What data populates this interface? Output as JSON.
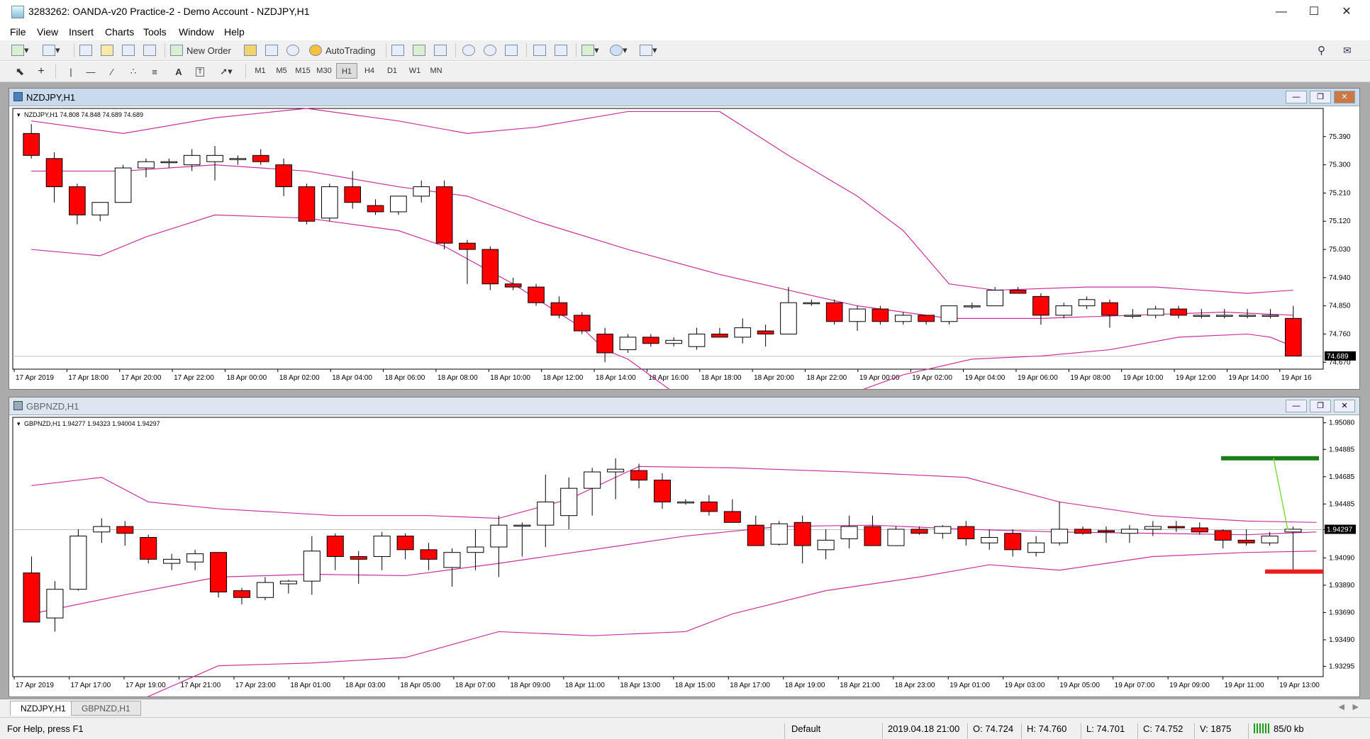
{
  "window": {
    "title": "3283262: OANDA-v20 Practice-2 - Demo Account - NZDJPY,H1",
    "minimize": "—",
    "maximize": "☐",
    "close": "✕"
  },
  "menu": [
    "File",
    "View",
    "Insert",
    "Charts",
    "Tools",
    "Window",
    "Help"
  ],
  "toolbar": {
    "new_order": "New Order",
    "autotrading": "AutoTrading"
  },
  "timeframes": [
    "M1",
    "M5",
    "M15",
    "M30",
    "H1",
    "H4",
    "D1",
    "W1",
    "MN"
  ],
  "active_timeframe": "H1",
  "tabs": [
    "NZDJPY,H1",
    "GBPNZD,H1"
  ],
  "status": {
    "help": "For Help, press F1",
    "profile": "Default",
    "datetime": "2019.04.18 21:00",
    "open": "O: 74.724",
    "high": "H: 74.760",
    "low": "L: 74.701",
    "close": "C: 74.752",
    "volume": "V: 1875",
    "traffic": "85/0 kb"
  },
  "colors": {
    "bear": "#ff0000",
    "bull": "#ffffff",
    "bands": "#cc2f9b",
    "tp_line": "#1a7d1a",
    "sl_line": "#ee1c1c"
  },
  "chart_data": [
    {
      "type": "candlestick",
      "window_title": "NZDJPY,H1",
      "info": "NZDJPY,H1  74.808 74.848 74.689 74.689",
      "price_labels": [
        "75.390",
        "75.300",
        "75.210",
        "75.120",
        "75.030",
        "74.940",
        "74.850",
        "74.760",
        "74.670"
      ],
      "current_price": "74.689",
      "ylim": [
        74.648,
        75.48
      ],
      "time_labels": [
        "17 Apr 2019",
        "17 Apr 18:00",
        "17 Apr 20:00",
        "17 Apr 22:00",
        "18 Apr 00:00",
        "18 Apr 02:00",
        "18 Apr 04:00",
        "18 Apr 06:00",
        "18 Apr 08:00",
        "18 Apr 10:00",
        "18 Apr 12:00",
        "18 Apr 14:00",
        "18 Apr 16:00",
        "18 Apr 18:00",
        "18 Apr 20:00",
        "18 Apr 22:00",
        "19 Apr 00:00",
        "19 Apr 02:00",
        "19 Apr 04:00",
        "19 Apr 06:00",
        "19 Apr 08:00",
        "19 Apr 10:00",
        "19 Apr 12:00",
        "19 Apr 14:00",
        "19 Apr 16"
      ],
      "candles": [
        [
          75.4,
          75.43,
          75.32,
          75.33
        ],
        [
          75.32,
          75.34,
          75.18,
          75.23
        ],
        [
          75.23,
          75.24,
          75.11,
          75.14
        ],
        [
          75.14,
          75.18,
          75.12,
          75.18
        ],
        [
          75.18,
          75.3,
          75.18,
          75.29
        ],
        [
          75.29,
          75.32,
          75.26,
          75.31
        ],
        [
          75.31,
          75.32,
          75.29,
          75.31
        ],
        [
          75.3,
          75.35,
          75.28,
          75.33
        ],
        [
          75.31,
          75.36,
          75.25,
          75.33
        ],
        [
          75.32,
          75.33,
          75.3,
          75.32
        ],
        [
          75.33,
          75.35,
          75.3,
          75.31
        ],
        [
          75.3,
          75.32,
          75.2,
          75.23
        ],
        [
          75.23,
          75.24,
          75.11,
          75.12
        ],
        [
          75.13,
          75.24,
          75.12,
          75.23
        ],
        [
          75.23,
          75.28,
          75.16,
          75.18
        ],
        [
          75.17,
          75.19,
          75.14,
          75.15
        ],
        [
          75.15,
          75.2,
          75.14,
          75.2
        ],
        [
          75.2,
          75.25,
          75.18,
          75.23
        ],
        [
          75.23,
          75.25,
          75.03,
          75.05
        ],
        [
          75.05,
          75.06,
          74.92,
          75.03
        ],
        [
          75.03,
          75.04,
          74.9,
          74.92
        ],
        [
          74.92,
          74.94,
          74.9,
          74.91
        ],
        [
          74.91,
          74.92,
          74.85,
          74.86
        ],
        [
          74.86,
          74.88,
          74.81,
          74.82
        ],
        [
          74.82,
          74.83,
          74.76,
          74.77
        ],
        [
          74.76,
          74.78,
          74.67,
          74.7
        ],
        [
          74.71,
          74.76,
          74.7,
          74.75
        ],
        [
          74.75,
          74.76,
          74.72,
          74.73
        ],
        [
          74.73,
          74.75,
          74.72,
          74.74
        ],
        [
          74.72,
          74.78,
          74.71,
          74.76
        ],
        [
          74.76,
          74.78,
          74.75,
          74.75
        ],
        [
          74.75,
          74.81,
          74.73,
          74.78
        ],
        [
          74.77,
          74.79,
          74.72,
          74.76
        ],
        [
          74.76,
          74.91,
          74.76,
          74.86
        ],
        [
          74.86,
          74.87,
          74.85,
          74.86
        ],
        [
          74.86,
          74.87,
          74.79,
          74.8
        ],
        [
          74.8,
          74.85,
          74.77,
          74.84
        ],
        [
          74.84,
          74.85,
          74.79,
          74.8
        ],
        [
          74.8,
          74.83,
          74.79,
          74.82
        ],
        [
          74.82,
          74.82,
          74.79,
          74.8
        ],
        [
          74.8,
          74.85,
          74.79,
          74.85
        ],
        [
          74.85,
          74.86,
          74.84,
          74.85
        ],
        [
          74.85,
          74.91,
          74.85,
          74.9
        ],
        [
          74.9,
          74.91,
          74.89,
          74.89
        ],
        [
          74.88,
          74.89,
          74.79,
          74.82
        ],
        [
          74.82,
          74.86,
          74.81,
          74.85
        ],
        [
          74.85,
          74.88,
          74.84,
          74.87
        ],
        [
          74.86,
          74.87,
          74.78,
          74.82
        ],
        [
          74.82,
          74.84,
          74.81,
          74.82
        ],
        [
          74.82,
          74.85,
          74.81,
          74.84
        ],
        [
          74.84,
          74.85,
          74.81,
          74.82
        ],
        [
          74.82,
          74.84,
          74.81,
          74.82
        ],
        [
          74.82,
          74.84,
          74.81,
          74.82
        ],
        [
          74.82,
          74.84,
          74.81,
          74.82
        ],
        [
          74.82,
          74.84,
          74.81,
          74.82
        ],
        [
          74.81,
          74.85,
          74.69,
          74.69
        ]
      ],
      "bands": {
        "upper": [
          [
            0,
            75.44
          ],
          [
            4,
            75.4
          ],
          [
            8,
            75.45
          ],
          [
            12,
            75.48
          ],
          [
            16,
            75.44
          ],
          [
            19,
            75.4
          ],
          [
            22,
            75.42
          ],
          [
            26,
            75.47
          ],
          [
            30,
            75.47
          ],
          [
            33,
            75.33
          ],
          [
            36,
            75.2
          ],
          [
            38,
            75.09
          ],
          [
            40,
            74.92
          ],
          [
            42,
            74.9
          ],
          [
            46,
            74.91
          ],
          [
            49,
            74.91
          ],
          [
            53,
            74.89
          ],
          [
            55,
            74.9
          ]
        ],
        "middle": [
          [
            0,
            75.28
          ],
          [
            4,
            75.28
          ],
          [
            8,
            75.3
          ],
          [
            12,
            75.28
          ],
          [
            16,
            75.23
          ],
          [
            19,
            75.2
          ],
          [
            22,
            75.12
          ],
          [
            26,
            75.03
          ],
          [
            30,
            74.95
          ],
          [
            33,
            74.9
          ],
          [
            36,
            74.85
          ],
          [
            40,
            74.81
          ],
          [
            44,
            74.81
          ],
          [
            48,
            74.82
          ],
          [
            52,
            74.83
          ],
          [
            55,
            74.82
          ]
        ],
        "lower": [
          [
            0,
            75.03
          ],
          [
            3,
            75.01
          ],
          [
            5,
            75.07
          ],
          [
            8,
            75.14
          ],
          [
            12,
            75.13
          ],
          [
            16,
            75.09
          ],
          [
            18,
            75.04
          ],
          [
            21,
            74.92
          ],
          [
            24,
            74.78
          ],
          [
            25,
            74.71
          ],
          [
            26,
            74.68
          ],
          [
            29,
            74.52
          ],
          [
            32,
            74.55
          ],
          [
            35,
            74.55
          ],
          [
            38,
            74.63
          ],
          [
            41,
            74.68
          ],
          [
            44,
            74.69
          ],
          [
            47,
            74.71
          ],
          [
            50,
            74.75
          ],
          [
            53,
            74.76
          ],
          [
            54,
            74.75
          ],
          [
            55,
            74.72
          ]
        ]
      }
    },
    {
      "type": "candlestick",
      "window_title": "GBPNZD,H1",
      "info": "GBPNZD,H1  1.94277 1.94323 1.94004 1.94297",
      "price_labels": [
        "1.95080",
        "1.94885",
        "1.94685",
        "1.94485",
        "1.94297",
        "1.94090",
        "1.93890",
        "1.93690",
        "1.93490",
        "1.93295"
      ],
      "current_price": "1.94297",
      "ylim": [
        1.9322,
        1.9512
      ],
      "tp_price": 1.9482,
      "sl_price": 1.9399,
      "time_labels": [
        "17 Apr 2019",
        "17 Apr 17:00",
        "17 Apr 19:00",
        "17 Apr 21:00",
        "17 Apr 23:00",
        "18 Apr 01:00",
        "18 Apr 03:00",
        "18 Apr 05:00",
        "18 Apr 07:00",
        "18 Apr 09:00",
        "18 Apr 11:00",
        "18 Apr 13:00",
        "18 Apr 15:00",
        "18 Apr 17:00",
        "18 Apr 19:00",
        "18 Apr 21:00",
        "18 Apr 23:00",
        "19 Apr 01:00",
        "19 Apr 03:00",
        "19 Apr 05:00",
        "19 Apr 07:00",
        "19 Apr 09:00",
        "19 Apr 11:00",
        "19 Apr 13:00"
      ],
      "candles": [
        [
          1.9398,
          1.941,
          1.937,
          1.9362
        ],
        [
          1.9365,
          1.9392,
          1.9355,
          1.9386
        ],
        [
          1.9386,
          1.943,
          1.9385,
          1.9425
        ],
        [
          1.9428,
          1.9438,
          1.942,
          1.9432
        ],
        [
          1.9432,
          1.9436,
          1.9418,
          1.9427
        ],
        [
          1.9424,
          1.9426,
          1.9405,
          1.9408
        ],
        [
          1.9405,
          1.9412,
          1.94,
          1.9408
        ],
        [
          1.9406,
          1.9415,
          1.94,
          1.9412
        ],
        [
          1.9413,
          1.9413,
          1.938,
          1.9384
        ],
        [
          1.9385,
          1.9387,
          1.9375,
          1.938
        ],
        [
          1.938,
          1.9395,
          1.9378,
          1.9391
        ],
        [
          1.939,
          1.9393,
          1.9383,
          1.9392
        ],
        [
          1.9392,
          1.9425,
          1.9382,
          1.9414
        ],
        [
          1.9425,
          1.9427,
          1.94,
          1.941
        ],
        [
          1.941,
          1.9414,
          1.939,
          1.9408
        ],
        [
          1.941,
          1.9428,
          1.94,
          1.9425
        ],
        [
          1.9425,
          1.9427,
          1.9408,
          1.9415
        ],
        [
          1.9415,
          1.942,
          1.94,
          1.9408
        ],
        [
          1.9402,
          1.9416,
          1.9388,
          1.9413
        ],
        [
          1.9413,
          1.943,
          1.94,
          1.9417
        ],
        [
          1.9417,
          1.944,
          1.9395,
          1.9433
        ],
        [
          1.9433,
          1.9435,
          1.941,
          1.9433
        ],
        [
          1.9433,
          1.947,
          1.9417,
          1.945
        ],
        [
          1.944,
          1.9468,
          1.943,
          1.946
        ],
        [
          1.946,
          1.9475,
          1.944,
          1.9472
        ],
        [
          1.9472,
          1.9482,
          1.9452,
          1.9474
        ],
        [
          1.9473,
          1.9478,
          1.946,
          1.9466
        ],
        [
          1.9466,
          1.9471,
          1.9445,
          1.945
        ],
        [
          1.945,
          1.9452,
          1.9448,
          1.945
        ],
        [
          1.945,
          1.9455,
          1.944,
          1.9443
        ],
        [
          1.9443,
          1.9452,
          1.9435,
          1.9435
        ],
        [
          1.9433,
          1.944,
          1.9418,
          1.9418
        ],
        [
          1.9419,
          1.9436,
          1.9418,
          1.9434
        ],
        [
          1.9435,
          1.944,
          1.9405,
          1.9418
        ],
        [
          1.9415,
          1.943,
          1.9408,
          1.9422
        ],
        [
          1.9423,
          1.944,
          1.9416,
          1.9432
        ],
        [
          1.9432,
          1.944,
          1.9418,
          1.9418
        ],
        [
          1.9418,
          1.9432,
          1.9418,
          1.943
        ],
        [
          1.943,
          1.9432,
          1.9426,
          1.9427
        ],
        [
          1.9427,
          1.9433,
          1.9423,
          1.9432
        ],
        [
          1.9432,
          1.9436,
          1.9418,
          1.9423
        ],
        [
          1.942,
          1.943,
          1.9415,
          1.9424
        ],
        [
          1.9427,
          1.943,
          1.941,
          1.9415
        ],
        [
          1.9413,
          1.9425,
          1.941,
          1.942
        ],
        [
          1.942,
          1.945,
          1.9418,
          1.943
        ],
        [
          1.943,
          1.9432,
          1.9426,
          1.9427
        ],
        [
          1.9429,
          1.9432,
          1.942,
          1.9428
        ],
        [
          1.9427,
          1.9433,
          1.942,
          1.943
        ],
        [
          1.943,
          1.9436,
          1.9425,
          1.9432
        ],
        [
          1.9432,
          1.9436,
          1.9428,
          1.9431
        ],
        [
          1.9431,
          1.9435,
          1.9426,
          1.9428
        ],
        [
          1.9429,
          1.943,
          1.9416,
          1.9422
        ],
        [
          1.9422,
          1.943,
          1.9418,
          1.942
        ],
        [
          1.942,
          1.9428,
          1.9418,
          1.9425
        ],
        [
          1.9428,
          1.9432,
          1.94,
          1.943
        ]
      ],
      "bands": {
        "upper": [
          [
            0,
            1.9462
          ],
          [
            3,
            1.9468
          ],
          [
            5,
            1.945
          ],
          [
            8,
            1.9445
          ],
          [
            13,
            1.944
          ],
          [
            17,
            1.944
          ],
          [
            20,
            1.9438
          ],
          [
            23,
            1.9452
          ],
          [
            26,
            1.9476
          ],
          [
            30,
            1.9475
          ],
          [
            35,
            1.9472
          ],
          [
            40,
            1.9468
          ],
          [
            44,
            1.945
          ],
          [
            48,
            1.944
          ],
          [
            52,
            1.9436
          ],
          [
            55,
            1.9435
          ]
        ],
        "middle": [
          [
            0,
            1.9368
          ],
          [
            4,
            1.9382
          ],
          [
            8,
            1.9395
          ],
          [
            12,
            1.9397
          ],
          [
            16,
            1.9396
          ],
          [
            20,
            1.9405
          ],
          [
            24,
            1.9415
          ],
          [
            28,
            1.9425
          ],
          [
            32,
            1.9432
          ],
          [
            36,
            1.9433
          ],
          [
            40,
            1.943
          ],
          [
            44,
            1.9428
          ],
          [
            48,
            1.9427
          ],
          [
            52,
            1.9426
          ],
          [
            55,
            1.9428
          ]
        ],
        "lower": [
          [
            0,
            1.9298
          ],
          [
            4,
            1.93
          ],
          [
            8,
            1.933
          ],
          [
            12,
            1.9332
          ],
          [
            16,
            1.9336
          ],
          [
            20,
            1.9355
          ],
          [
            24,
            1.9352
          ],
          [
            28,
            1.9355
          ],
          [
            30,
            1.9368
          ],
          [
            34,
            1.9385
          ],
          [
            38,
            1.9395
          ],
          [
            41,
            1.9404
          ],
          [
            44,
            1.94
          ],
          [
            48,
            1.941
          ],
          [
            52,
            1.9413
          ],
          [
            55,
            1.9414
          ]
        ]
      }
    }
  ]
}
